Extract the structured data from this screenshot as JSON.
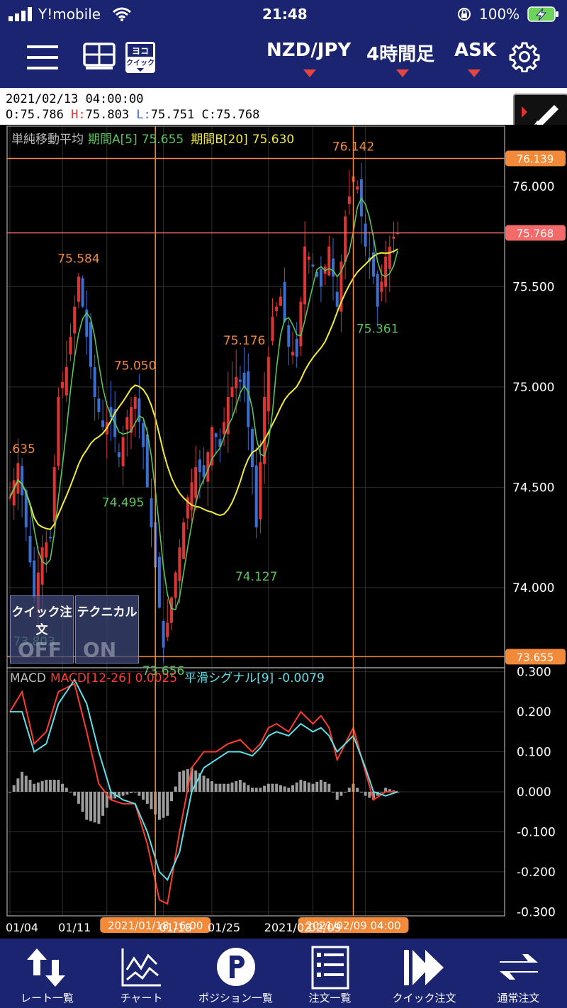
{
  "status": {
    "carrier": "Y!mobile",
    "time": "21:48",
    "battery": "100%"
  },
  "toolbar": {
    "pair": "NZD/JPY",
    "timeframe": "4時間足",
    "side": "ASK"
  },
  "info": {
    "datetime": "2021/02/13  04:00:00",
    "open_label": "O:",
    "open": "75.786",
    "high_label": "H:",
    "high": "75.803",
    "low_label": "L:",
    "low": "75.751",
    "close_label": "C:",
    "close": "75.768"
  },
  "chart_data": {
    "type": "candlestick",
    "price_axis": {
      "range": [
        73.6,
        76.3
      ],
      "ticks": [
        "76.000",
        "75.500",
        "75.000",
        "74.500",
        "74.000"
      ]
    },
    "macd_axis": {
      "range": [
        -0.31,
        0.31
      ],
      "ticks": [
        "0.300",
        "0.200",
        "0.100",
        "0.000",
        "-0.100",
        "-0.200",
        "-0.300"
      ]
    },
    "x_labels": [
      "01/04",
      "01/11",
      "01/18",
      "01/25",
      "2021/02",
      "02/09"
    ],
    "sma_legend": {
      "name": "単純移動平均",
      "a_label": "期間A[5]",
      "a_value": "75.655",
      "b_label": "期間B[20]",
      "b_value": "75.630"
    },
    "macd_legend": {
      "name": "MACD",
      "macd_label": "MACD[12-26]",
      "macd_value": "0.0025",
      "signal_label": "平滑シグナル[9]",
      "signal_value": "-0.0079"
    },
    "hlines": [
      {
        "label": "76.139",
        "price": 76.139
      },
      {
        "label": "75.768",
        "price": 75.768
      },
      {
        "label": "73.655",
        "price": 73.655
      }
    ],
    "vlines": [
      {
        "label": "2021/01/18 16:00",
        "index": 36
      },
      {
        "label": "2021/02/09 04:00",
        "index": 85
      }
    ],
    "extremes": [
      {
        "label": "76.142",
        "kind": "high",
        "index": 85,
        "price": 76.142
      },
      {
        "label": "75.584",
        "kind": "high",
        "index": 17,
        "price": 75.584
      },
      {
        "label": "75.176",
        "kind": "high",
        "index": 58,
        "price": 75.176
      },
      {
        "label": "75.050",
        "kind": "high",
        "index": 31,
        "price": 75.05
      },
      {
        "label": ".635",
        "kind": "high",
        "index": 2,
        "price": 74.635
      },
      {
        "label": "74.495",
        "kind": "low",
        "index": 28,
        "price": 74.495
      },
      {
        "label": "74.127",
        "kind": "low",
        "index": 61,
        "price": 74.127
      },
      {
        "label": "75.361",
        "kind": "low",
        "index": 91,
        "price": 75.361
      },
      {
        "label": "73.803",
        "kind": "low",
        "index": 6,
        "price": 73.803
      },
      {
        "label": "73.656",
        "kind": "low",
        "index": 38,
        "price": 73.656
      }
    ],
    "close_path": [
      [
        0,
        74.45
      ],
      [
        2,
        74.62
      ],
      [
        4,
        74.3
      ],
      [
        6,
        73.95
      ],
      [
        8,
        74.2
      ],
      [
        10,
        74.25
      ],
      [
        12,
        74.95
      ],
      [
        14,
        75.1
      ],
      [
        16,
        75.4
      ],
      [
        17,
        75.55
      ],
      [
        19,
        75.25
      ],
      [
        21,
        74.95
      ],
      [
        23,
        74.8
      ],
      [
        25,
        74.85
      ],
      [
        27,
        74.65
      ],
      [
        29,
        74.85
      ],
      [
        31,
        74.95
      ],
      [
        33,
        74.7
      ],
      [
        35,
        74.3
      ],
      [
        37,
        73.9
      ],
      [
        38,
        73.7
      ],
      [
        40,
        73.95
      ],
      [
        42,
        74.2
      ],
      [
        44,
        74.45
      ],
      [
        46,
        74.6
      ],
      [
        48,
        74.55
      ],
      [
        50,
        74.8
      ],
      [
        52,
        74.7
      ],
      [
        54,
        74.95
      ],
      [
        56,
        75.05
      ],
      [
        58,
        75.0
      ],
      [
        60,
        74.6
      ],
      [
        61,
        74.3
      ],
      [
        63,
        74.95
      ],
      [
        65,
        75.35
      ],
      [
        67,
        75.45
      ],
      [
        69,
        75.2
      ],
      [
        71,
        75.15
      ],
      [
        73,
        75.7
      ],
      [
        75,
        75.6
      ],
      [
        77,
        75.5
      ],
      [
        79,
        75.7
      ],
      [
        81,
        75.4
      ],
      [
        83,
        75.85
      ],
      [
        85,
        76.05
      ],
      [
        86,
        76.0
      ],
      [
        88,
        75.7
      ],
      [
        90,
        75.55
      ],
      [
        91,
        75.4
      ],
      [
        93,
        75.65
      ],
      [
        95,
        75.75
      ],
      [
        96,
        75.77
      ]
    ],
    "macd_line": [
      [
        0,
        0.2
      ],
      [
        3,
        0.25
      ],
      [
        6,
        0.12
      ],
      [
        9,
        0.15
      ],
      [
        12,
        0.25
      ],
      [
        16,
        0.27
      ],
      [
        19,
        0.15
      ],
      [
        22,
        0.02
      ],
      [
        25,
        -0.02
      ],
      [
        28,
        -0.03
      ],
      [
        31,
        -0.03
      ],
      [
        34,
        -0.13
      ],
      [
        37,
        -0.27
      ],
      [
        39,
        -0.28
      ],
      [
        42,
        -0.1
      ],
      [
        45,
        0.06
      ],
      [
        48,
        0.1
      ],
      [
        51,
        0.1
      ],
      [
        54,
        0.12
      ],
      [
        57,
        0.13
      ],
      [
        60,
        0.1
      ],
      [
        62,
        0.12
      ],
      [
        64,
        0.16
      ],
      [
        66,
        0.17
      ],
      [
        69,
        0.15
      ],
      [
        72,
        0.2
      ],
      [
        75,
        0.17
      ],
      [
        77,
        0.19
      ],
      [
        79,
        0.16
      ],
      [
        81,
        0.08
      ],
      [
        83,
        0.12
      ],
      [
        85,
        0.16
      ],
      [
        88,
        0.05
      ],
      [
        90,
        -0.02
      ],
      [
        93,
        0.0
      ],
      [
        96,
        0.0
      ]
    ],
    "signal_line": [
      [
        0,
        0.2
      ],
      [
        3,
        0.2
      ],
      [
        6,
        0.1
      ],
      [
        9,
        0.12
      ],
      [
        12,
        0.22
      ],
      [
        16,
        0.28
      ],
      [
        19,
        0.22
      ],
      [
        22,
        0.1
      ],
      [
        25,
        0.0
      ],
      [
        28,
        -0.02
      ],
      [
        31,
        -0.03
      ],
      [
        34,
        -0.1
      ],
      [
        37,
        -0.2
      ],
      [
        39,
        -0.22
      ],
      [
        42,
        -0.15
      ],
      [
        45,
        0.0
      ],
      [
        48,
        0.06
      ],
      [
        51,
        0.08
      ],
      [
        54,
        0.1
      ],
      [
        57,
        0.1
      ],
      [
        60,
        0.09
      ],
      [
        62,
        0.11
      ],
      [
        64,
        0.14
      ],
      [
        66,
        0.15
      ],
      [
        69,
        0.14
      ],
      [
        72,
        0.17
      ],
      [
        75,
        0.15
      ],
      [
        77,
        0.16
      ],
      [
        79,
        0.14
      ],
      [
        81,
        0.1
      ],
      [
        83,
        0.12
      ],
      [
        85,
        0.14
      ],
      [
        88,
        0.06
      ],
      [
        90,
        0.0
      ],
      [
        93,
        -0.01
      ],
      [
        96,
        0.0
      ]
    ]
  },
  "overlays": {
    "quick_title": "クイック注文",
    "quick_state": "OFF",
    "tech_title": "テクニカル",
    "tech_state": "ON"
  },
  "tabs": [
    {
      "id": "rate-list",
      "label": "レート一覧",
      "icon": "up-down-arrows-icon"
    },
    {
      "id": "chart",
      "label": "チャート",
      "icon": "line-chart-icon"
    },
    {
      "id": "position-list",
      "label": "ポジション一覧",
      "icon": "p-circle-icon"
    },
    {
      "id": "order-list",
      "label": "注文一覧",
      "icon": "order-list-icon"
    },
    {
      "id": "quick-order",
      "label": "クイック注文",
      "icon": "fast-forward-icon"
    },
    {
      "id": "normal-order",
      "label": "通常注文",
      "icon": "transfer-arrows-icon"
    }
  ],
  "colors": {
    "bar": "#1b2470",
    "up": "#e03434",
    "down": "#3a6fd0",
    "sma_a": "#5ac35a",
    "sma_b": "#f2ea3a",
    "hline": "#f28a3a",
    "ask_line": "#f26a6a",
    "macd": "#ff3b30",
    "signal": "#5ee0e8",
    "hist": "#9c9c9c"
  }
}
